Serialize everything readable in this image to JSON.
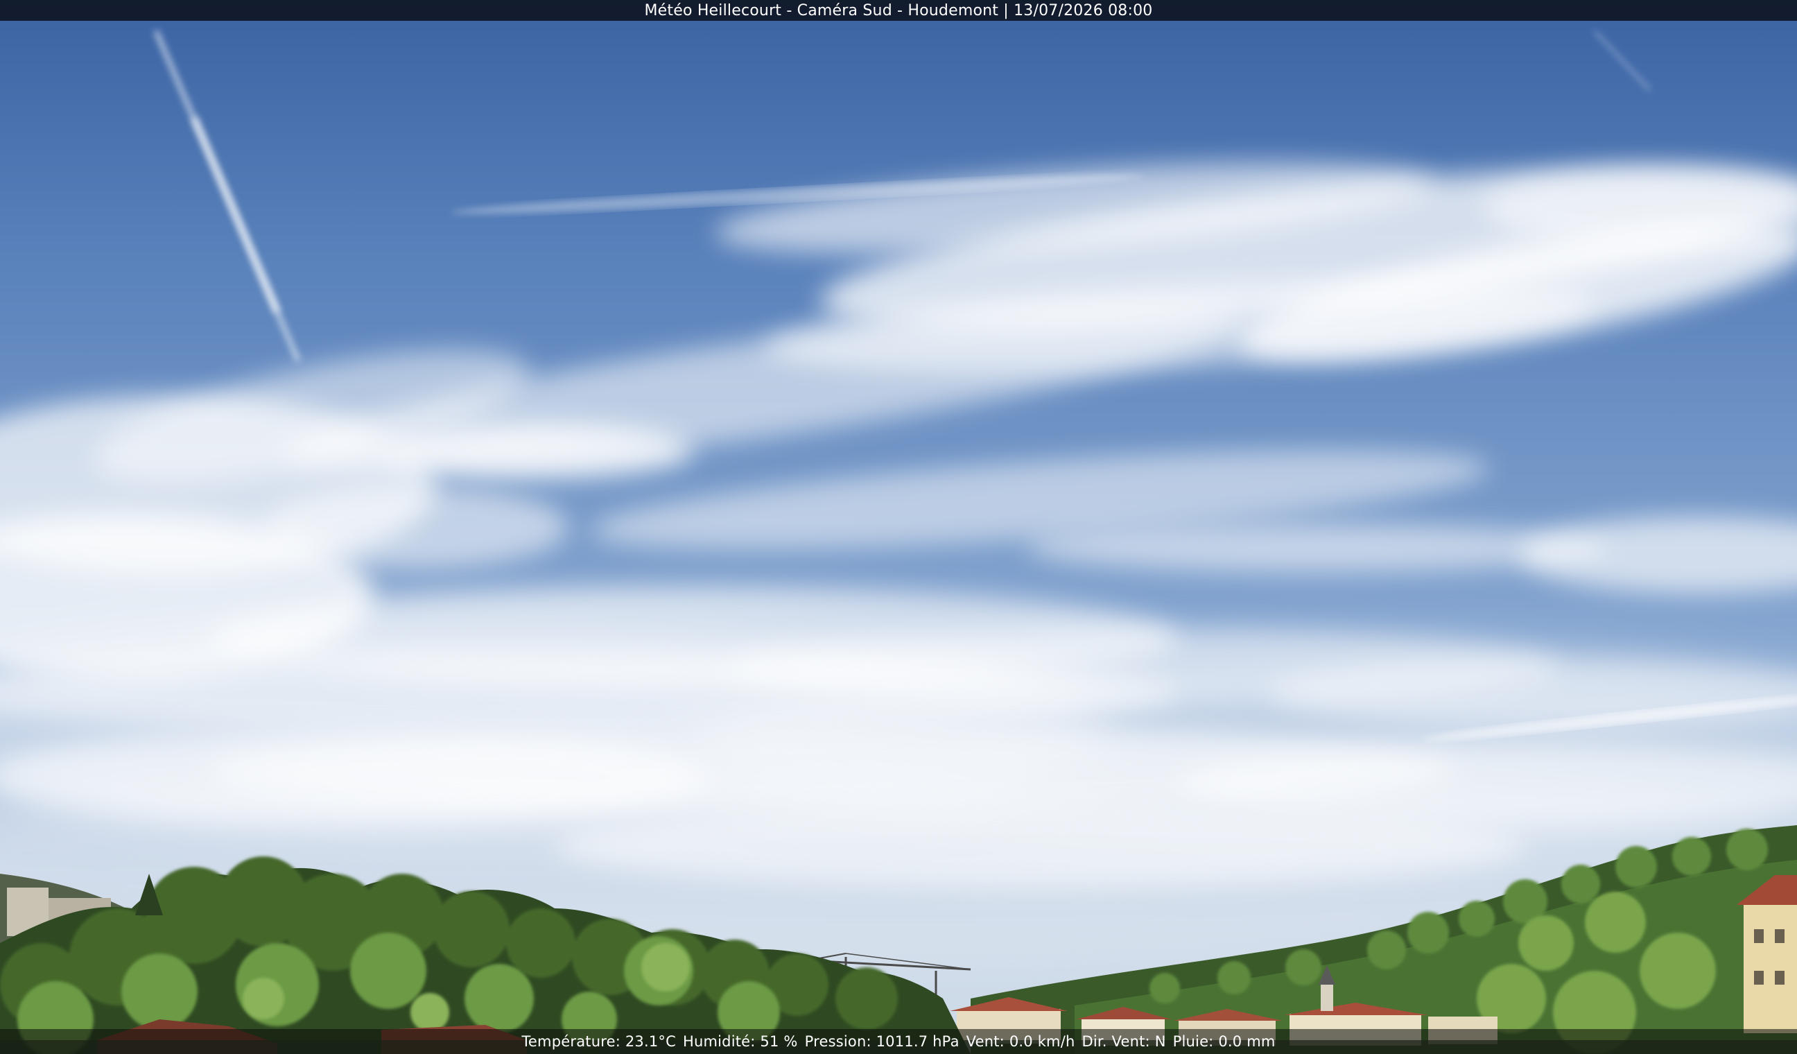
{
  "webcam": {
    "title": "Météo Heillecourt - Caméra Sud - Houdemont | 13/07/2026 08:00"
  },
  "readings": {
    "temperature": "Température: 23.1°C",
    "humidity": "Humidité: 51 %",
    "pressure": "Pression: 1011.7 hPa",
    "wind_speed": "Vent: 0.0 km/h",
    "wind_dir": "Dir. Vent: N",
    "rain": "Pluie: 0.0 mm"
  },
  "colors": {
    "sky_top": "#3f68a8",
    "sky_mid": "#7f9fcc",
    "sky_horizon": "#c9d6e6",
    "cloud": "#ffffff",
    "tree_dark": "#2f4a22",
    "tree_light": "#6d9a44",
    "roof": "#a8503c",
    "wall": "#e8dcc0"
  },
  "scene": {
    "icons": [
      "contrail",
      "cirrus-clouds",
      "tree-line",
      "hillside-forest",
      "construction-crane",
      "church-steeple",
      "houses"
    ]
  }
}
